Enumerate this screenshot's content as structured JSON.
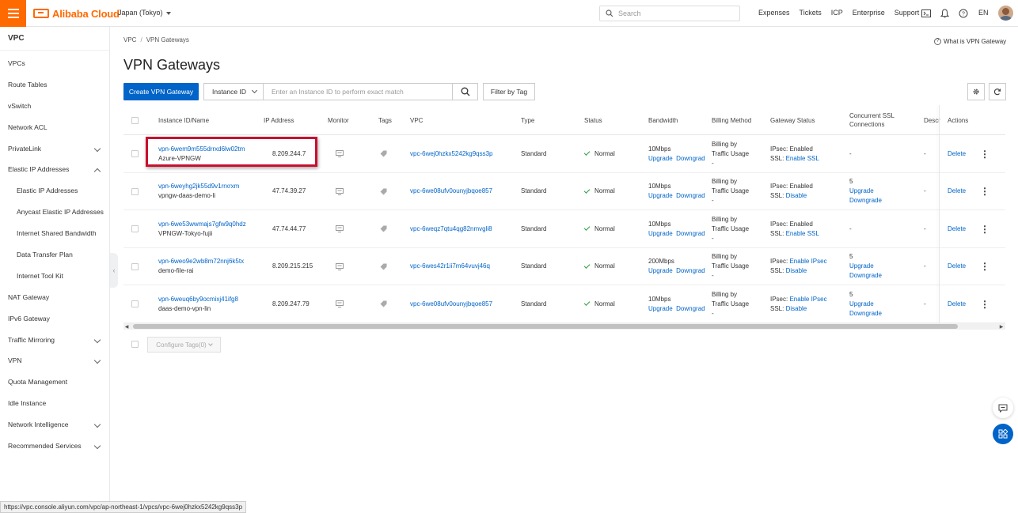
{
  "topbar": {
    "brand": "Alibaba Cloud",
    "region": "Japan (Tokyo)",
    "search_placeholder": "Search",
    "links": [
      "Expenses",
      "Tickets",
      "ICP",
      "Enterprise",
      "Support"
    ],
    "language": "EN",
    "accent": "#ff6a00"
  },
  "sidebar": {
    "title": "VPC",
    "items": [
      {
        "label": "VPCs",
        "sub": false,
        "chevron": ""
      },
      {
        "label": "Route Tables",
        "sub": false,
        "chevron": ""
      },
      {
        "label": "vSwitch",
        "sub": false,
        "chevron": ""
      },
      {
        "label": "Network ACL",
        "sub": false,
        "chevron": ""
      },
      {
        "label": "PrivateLink",
        "sub": false,
        "chevron": "down"
      },
      {
        "label": "Elastic IP Addresses",
        "sub": false,
        "chevron": "up"
      },
      {
        "label": "Elastic IP Addresses",
        "sub": true,
        "chevron": ""
      },
      {
        "label": "Anycast Elastic IP Addresses",
        "sub": true,
        "chevron": ""
      },
      {
        "label": "Internet Shared Bandwidth",
        "sub": true,
        "chevron": ""
      },
      {
        "label": "Data Transfer Plan",
        "sub": true,
        "chevron": ""
      },
      {
        "label": "Internet Tool Kit",
        "sub": true,
        "chevron": ""
      },
      {
        "label": "NAT Gateway",
        "sub": false,
        "chevron": ""
      },
      {
        "label": "IPv6 Gateway",
        "sub": false,
        "chevron": ""
      },
      {
        "label": "Traffic Mirroring",
        "sub": false,
        "chevron": "down"
      },
      {
        "label": "VPN",
        "sub": false,
        "chevron": "down"
      },
      {
        "label": "Quota Management",
        "sub": false,
        "chevron": ""
      },
      {
        "label": "Idle Instance",
        "sub": false,
        "chevron": ""
      },
      {
        "label": "Network Intelligence",
        "sub": false,
        "chevron": "down"
      },
      {
        "label": "Recommended Services",
        "sub": false,
        "chevron": "down"
      }
    ]
  },
  "breadcrumb": {
    "root": "VPC",
    "current": "VPN Gateways",
    "separator": "/"
  },
  "help_link": "What is VPN Gateway",
  "page_title": "VPN Gateways",
  "toolbar": {
    "create_label": "Create VPN Gateway",
    "filter_select": "Instance ID",
    "filter_placeholder": "Enter an Instance ID to perform exact match",
    "filter_by_tag": "Filter by Tag"
  },
  "table": {
    "headers": {
      "instance": "Instance ID/Name",
      "ip": "IP Address",
      "monitor": "Monitor",
      "tags": "Tags",
      "vpc": "VPC",
      "type": "Type",
      "status": "Status",
      "bandwidth": "Bandwidth",
      "billing": "Billing Method",
      "gateway_status": "Gateway Status",
      "ssl_line1": "Concurrent SSL",
      "ssl_line2": "Connections",
      "desc": "Descr",
      "actions": "Actions"
    },
    "rows": [
      {
        "id": "vpn-6wem9m555drrxd6lw02tm",
        "name": "Azure-VPNGW",
        "ip": "8.209.244.7",
        "vpc": "vpc-6wej0hzkx5242kg9qss3p",
        "type": "Standard",
        "status": "Normal",
        "bandwidth": "10Mbps",
        "upgrade": "Upgrade",
        "downgrade": "Downgrade",
        "billing1": "Billing by",
        "billing2": "Traffic Usage",
        "billing3": "-",
        "ipsec_prefix": "IPsec: ",
        "ipsec_value": "Enabled",
        "ssl_prefix": "SSL: ",
        "ssl_value": "Enable SSL",
        "ssl_conn": "-",
        "ssl_up": "",
        "ssl_down": "",
        "desc": "-",
        "delete": "Delete"
      },
      {
        "id": "vpn-6weyhg2jk55d9v1rrxrxm",
        "name": "vpngw-daas-demo-li",
        "ip": "47.74.39.27",
        "vpc": "vpc-6we08ufv0ounyjbqoe857",
        "type": "Standard",
        "status": "Normal",
        "bandwidth": "10Mbps",
        "upgrade": "Upgrade",
        "downgrade": "Downgrade",
        "billing1": "Billing by",
        "billing2": "Traffic Usage",
        "billing3": "-",
        "ipsec_prefix": "IPsec: ",
        "ipsec_value": "Enabled",
        "ssl_prefix": "SSL: ",
        "ssl_value": "Disable",
        "ssl_conn": "5",
        "ssl_up": "Upgrade",
        "ssl_down": "Downgrade",
        "desc": "-",
        "delete": "Delete"
      },
      {
        "id": "vpn-6we53wwmajs7gfw9q0hdz",
        "name": "VPNGW-Tokyo-fujii",
        "ip": "47.74.44.77",
        "vpc": "vpc-6weqz7qtu4qg82nmvgli8",
        "type": "Standard",
        "status": "Normal",
        "bandwidth": "10Mbps",
        "upgrade": "Upgrade",
        "downgrade": "Downgrade",
        "billing1": "Billing by",
        "billing2": "Traffic Usage",
        "billing3": "-",
        "ipsec_prefix": "IPsec: ",
        "ipsec_value": "Enabled",
        "ssl_prefix": "SSL: ",
        "ssl_value": "Enable SSL",
        "ssl_conn": "-",
        "ssl_up": "",
        "ssl_down": "",
        "desc": "-",
        "delete": "Delete"
      },
      {
        "id": "vpn-6weo9e2wb8m72nnj6k5tx",
        "name": "demo-file-rai",
        "ip": "8.209.215.215",
        "vpc": "vpc-6wes42r1ii7m64vuvj46q",
        "type": "Standard",
        "status": "Normal",
        "bandwidth": "200Mbps",
        "upgrade": "Upgrade",
        "downgrade": "Downgrade",
        "billing1": "Billing by",
        "billing2": "Traffic Usage",
        "billing3": "-",
        "ipsec_prefix": "IPsec: ",
        "ipsec_value": "Enable IPsec",
        "ssl_prefix": "SSL: ",
        "ssl_value": "Disable",
        "ssl_conn": "5",
        "ssl_up": "Upgrade",
        "ssl_down": "Downgrade",
        "desc": "-",
        "delete": "Delete"
      },
      {
        "id": "vpn-6weuq6by9ocmixj41ifg8",
        "name": "daas-demo-vpn-lin",
        "ip": "8.209.247.79",
        "vpc": "vpc-6we08ufv0ounyjbqoe857",
        "type": "Standard",
        "status": "Normal",
        "bandwidth": "10Mbps",
        "upgrade": "Upgrade",
        "downgrade": "Downgrade",
        "billing1": "Billing by",
        "billing2": "Traffic Usage",
        "billing3": "-",
        "ipsec_prefix": "IPsec: ",
        "ipsec_value": "Enable IPsec",
        "ssl_prefix": "SSL: ",
        "ssl_value": "Disable",
        "ssl_conn": "5",
        "ssl_up": "Upgrade",
        "ssl_down": "Downgrade",
        "desc": "-",
        "delete": "Delete"
      }
    ]
  },
  "configure_tags": "Configure Tags(0)",
  "status_bar_url": "https://vpc.console.aliyun.com/vpc/ap-northeast-1/vpcs/vpc-6wej0hzkx5242kg9qss3p",
  "colors": {
    "primary": "#0064c8",
    "success": "#2a9d3a",
    "highlight": "#c8102e"
  }
}
